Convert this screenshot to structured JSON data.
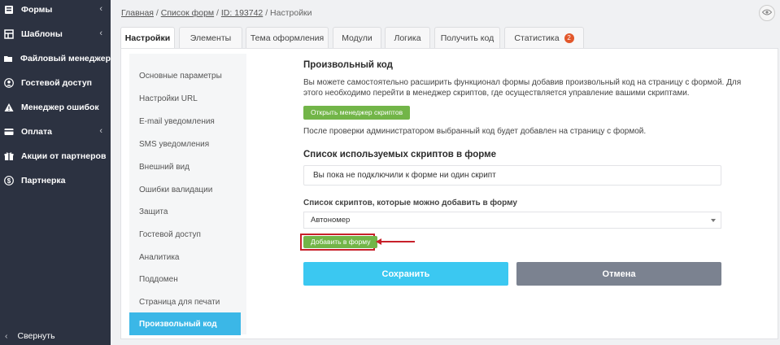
{
  "sidebar": {
    "items": [
      {
        "label": "Формы",
        "icon": "forms-icon",
        "chevron": "‹"
      },
      {
        "label": "Шаблоны",
        "icon": "templates-icon",
        "chevron": "‹"
      },
      {
        "label": "Файловый менеджер",
        "icon": "file-manager-icon",
        "chevron": ""
      },
      {
        "label": "Гостевой доступ",
        "icon": "user-icon",
        "chevron": ""
      },
      {
        "label": "Менеджер ошибок",
        "icon": "warning-icon",
        "chevron": ""
      },
      {
        "label": "Оплата",
        "icon": "card-icon",
        "chevron": "‹"
      },
      {
        "label": "Акции от партнеров",
        "icon": "gift-icon",
        "chevron": ""
      },
      {
        "label": "Партнерка",
        "icon": "dollar-icon",
        "chevron": ""
      }
    ],
    "collapse_label": "Свернуть",
    "collapse_chevron": "‹"
  },
  "breadcrumb": {
    "home": "Главная",
    "forms": "Список форм",
    "id": "ID: 193742",
    "sep": "/",
    "current": "Настройки"
  },
  "tabs": [
    {
      "label": "Настройки",
      "active": true
    },
    {
      "label": "Элементы"
    },
    {
      "label": "Тема оформления"
    },
    {
      "label": "Модули"
    },
    {
      "label": "Логика"
    },
    {
      "label": "Получить код"
    },
    {
      "label": "Статистика",
      "badge": "2"
    }
  ],
  "left_nav": [
    "Основные параметры",
    "Настройки URL",
    "E-mail уведомления",
    "SMS уведомления",
    "Внешний вид",
    "Ошибки валидации",
    "Защита",
    "Гостевой доступ",
    "Аналитика",
    "Поддомен",
    "Страница для печати",
    "Произвольный код"
  ],
  "content": {
    "title": "Произвольный код",
    "desc_line1": "Вы можете самостоятельно расширить функционал формы добавив произвольный код на страницу с формой. Для",
    "desc_line2": "этого необходимо перейти в менеджер скриптов, где осуществляется управление вашими скриптами.",
    "open_manager_button": "Открыть менеджер скриптов",
    "note": "После проверки администратором выбранный код будет добавлен на страницу с формой.",
    "used_title": "Список используемых скриптов в форме",
    "used_empty": "Вы пока не подключили к форме ни один скрипт",
    "available_title": "Список скриптов, которые можно добавить в форму",
    "selected_script": "Автономер",
    "add_button": "Добавить в форму",
    "save_button": "Сохранить",
    "cancel_button": "Отмена"
  },
  "colors": {
    "sidebar_bg": "#2c3241",
    "accent": "#3bb7e7",
    "green": "#72b548",
    "badge": "#e2572b",
    "highlight": "#c8202a"
  }
}
